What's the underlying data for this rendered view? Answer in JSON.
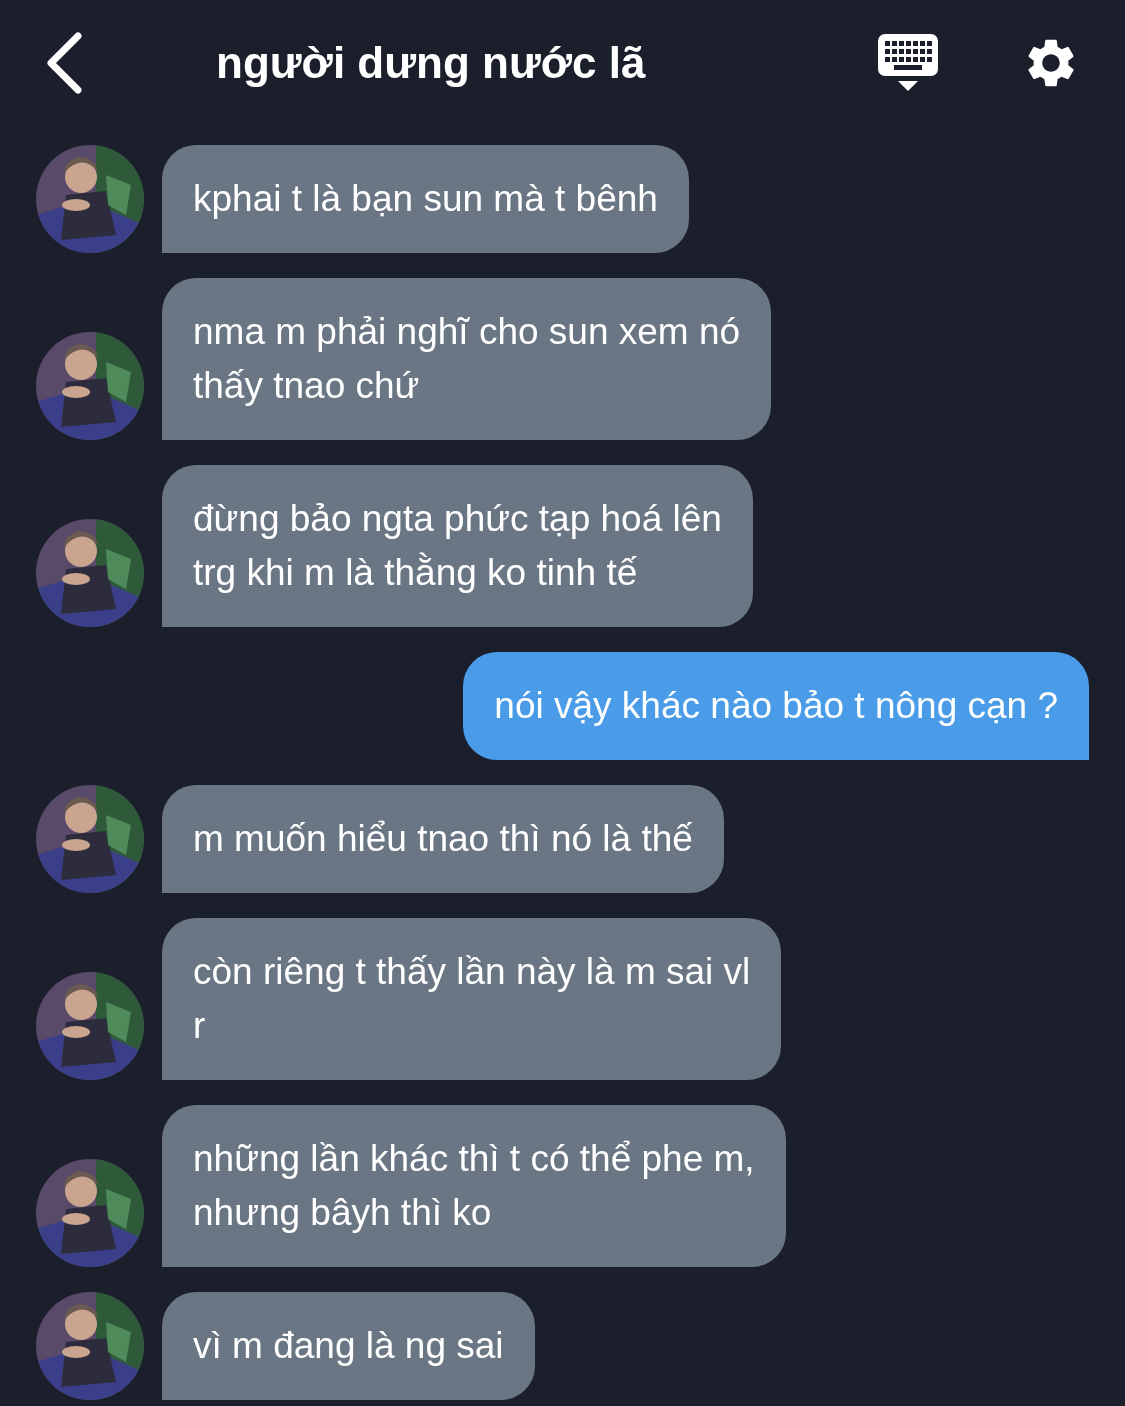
{
  "header": {
    "title": "người dưng nước lã"
  },
  "messages": [
    {
      "kind": "received",
      "lines": [
        "kphai t là bạn sun mà t bênh"
      ]
    },
    {
      "kind": "received",
      "lines": [
        "nma m phải nghĩ cho sun xem nó",
        "thấy tnao chứ"
      ]
    },
    {
      "kind": "received",
      "lines": [
        "đừng bảo ngta phức tạp hoá lên",
        "trg khi m là thằng ko tinh tế"
      ]
    },
    {
      "kind": "sent",
      "lines": [
        "nói vậy khác nào bảo t nông cạn ?"
      ]
    },
    {
      "kind": "received",
      "lines": [
        "m muốn hiểu tnao thì nó là thế"
      ]
    },
    {
      "kind": "received",
      "lines": [
        "còn riêng t thấy lần này là m sai vl",
        "r"
      ]
    },
    {
      "kind": "received",
      "lines": [
        "những lần khác thì t có thể phe m,",
        "nhưng bâyh thì ko"
      ]
    },
    {
      "kind": "received",
      "lines": [
        "vì m đang là ng sai"
      ]
    }
  ]
}
